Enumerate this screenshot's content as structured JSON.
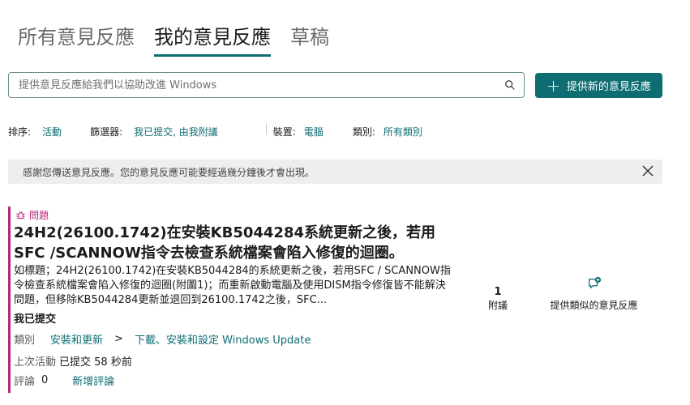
{
  "tabs": [
    {
      "label": "所有意見反應",
      "active": false
    },
    {
      "label": "我的意見反應",
      "active": true
    },
    {
      "label": "草稿",
      "active": false
    }
  ],
  "search": {
    "placeholder": "提供意見反應給我們以協助改進 Windows"
  },
  "new_feedback_button": {
    "label": "提供新的意見反應"
  },
  "filters": {
    "sort_label": "排序:",
    "sort_value": "活動",
    "filter_label": "篩選器:",
    "filter_value": "我已提交, 由我附議",
    "device_label": "裝置:",
    "device_value": "電腦",
    "category_label": "類別:",
    "category_value": "所有類別"
  },
  "notice": {
    "text": "感謝您傳送意見反應。您的意見反應可能要經過幾分鐘後才會出現。"
  },
  "feedback_item": {
    "type_label": "問題",
    "title": "24H2(26100.1742)在安裝KB5044284系統更新之後，若用SFC /SCANNOW指令去檢查系統檔案會陷入修復的迴圈。",
    "description": "如標題；24H2(26100.1742)在安裝KB5044284的系統更新之後，若用SFC / SCANNOW指令檢查系統檔案會陷入修復的迴圈(附圖1)；而重新啟動電腦及使用DISM指令修復皆不能解決問題，但移除KB5044284更新並退回到26100.1742之後，SFC...",
    "status": "我已提交",
    "category_label": "類別",
    "category_main": "安裝和更新",
    "category_separator": ">",
    "category_sub": "下載、安裝和設定 Windows Update",
    "last_activity_label": "上次活動",
    "last_activity_value": "已提交 58 秒前",
    "comments_label": "評論",
    "comments_count": "0",
    "add_comment_label": "新增評論",
    "upvotes_count": "1",
    "upvotes_label": "附議",
    "similar_label": "提供類似的意見反應"
  },
  "colors": {
    "accent": "#0e6d73",
    "problem": "#b8267b",
    "notice_bg": "#eeeeee"
  }
}
